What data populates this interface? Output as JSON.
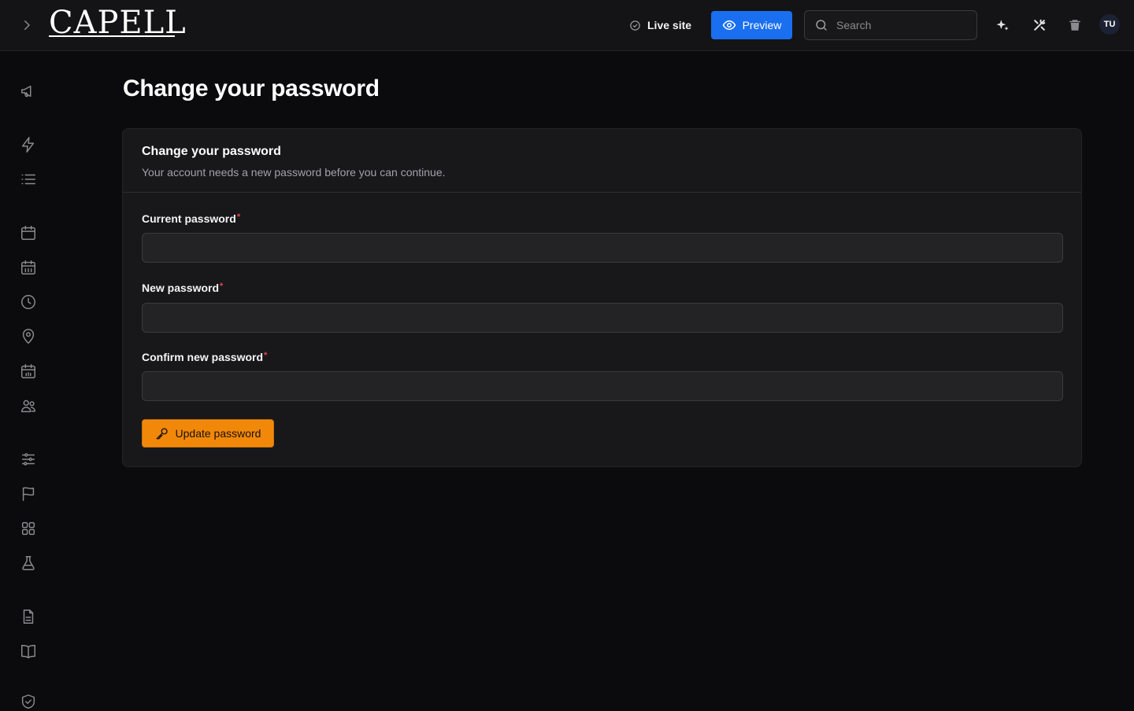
{
  "app": {
    "logo_text": "CAPELL"
  },
  "header": {
    "live_site_label": "Live site",
    "preview_label": "Preview",
    "search_placeholder": "Search",
    "avatar_initials": "TU"
  },
  "sidebar": {
    "icons": [
      "megaphone-icon",
      "lightning-icon",
      "list-icon",
      "calendar-icon",
      "calendar-grid-icon",
      "clock-icon",
      "location-pin-icon",
      "calendar-events-icon",
      "users-icon",
      "sliders-icon",
      "flag-icon",
      "apps-grid-icon",
      "flask-icon",
      "document-icon",
      "book-icon",
      "shield-check-icon"
    ]
  },
  "page": {
    "title": "Change your password"
  },
  "card": {
    "title": "Change your password",
    "description": "Your account needs a new password before you can continue.",
    "fields": [
      {
        "label": "Current password",
        "required_mark": "*",
        "value": ""
      },
      {
        "label": "New password",
        "required_mark": "*",
        "value": ""
      },
      {
        "label": "Confirm new password",
        "required_mark": "*",
        "value": ""
      }
    ],
    "submit_label": "Update password"
  },
  "colors": {
    "background": "#0b0b0d",
    "topbar": "#141416",
    "preview_accent": "#1a6ff0",
    "submit_accent": "#f2880a",
    "required_mark": "#e5484d"
  }
}
